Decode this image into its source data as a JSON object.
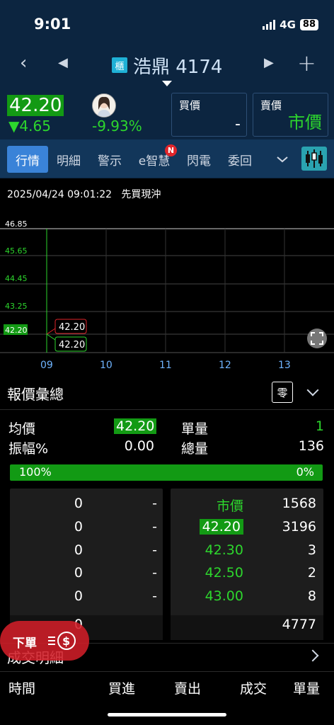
{
  "status_bar": {
    "time": "9:01",
    "network": "4G",
    "battery": "88"
  },
  "header": {
    "badge": "櫃",
    "title": "浩鼎 4174"
  },
  "quote": {
    "price": "42.20",
    "change": "▼4.65",
    "change_pct": "-9.93%",
    "bid_label": "買價",
    "bid_value": "-",
    "ask_label": "賣價",
    "ask_value": "市價"
  },
  "tabs": [
    {
      "label": "行情"
    },
    {
      "label": "明細"
    },
    {
      "label": "警示"
    },
    {
      "label": "e智慧"
    },
    {
      "label": "閃電"
    },
    {
      "label": "委回"
    }
  ],
  "tab_badge": "N",
  "chart": {
    "timestamp": "2025/04/24 09:01:22",
    "status": "先買現沖",
    "y_labels": [
      "46.85",
      "45.65",
      "44.45",
      "43.25",
      "42.20"
    ],
    "x_labels": [
      "09",
      "10",
      "11",
      "12",
      "13"
    ],
    "hi_tag": "42.20",
    "lo_tag": "42.20"
  },
  "summary": {
    "title": "報價彙總",
    "odd_lot_button": "零",
    "avg_label": "均價",
    "avg_value": "42.20",
    "unit_label": "單量",
    "unit_value": "1",
    "amp_label": "振幅%",
    "amp_value": "0.00",
    "total_label": "總量",
    "total_value": "136",
    "buy_pct": "100%",
    "sell_pct": "0%"
  },
  "order_book": {
    "bids": [
      {
        "qty": "0",
        "price": "-"
      },
      {
        "qty": "0",
        "price": "-"
      },
      {
        "qty": "0",
        "price": "-"
      },
      {
        "qty": "0",
        "price": "-"
      },
      {
        "qty": "0",
        "price": "-"
      }
    ],
    "bid_total": "0",
    "asks": [
      {
        "price": "市價",
        "qty": "1568"
      },
      {
        "price": "42.20",
        "qty": "3196"
      },
      {
        "price": "42.30",
        "qty": "3"
      },
      {
        "price": "42.50",
        "qty": "2"
      },
      {
        "price": "43.00",
        "qty": "8"
      }
    ],
    "ask_total": "4777"
  },
  "order_button": {
    "label": "下單"
  },
  "trades": {
    "title": "成交明細",
    "headers": [
      "時間",
      "買進",
      "賣出",
      "成交",
      "單量"
    ]
  },
  "colors": {
    "up": "#2dd62d",
    "accent": "#3a83d8",
    "header_bg": "#0c2540",
    "tag_red": "#e0252a"
  }
}
